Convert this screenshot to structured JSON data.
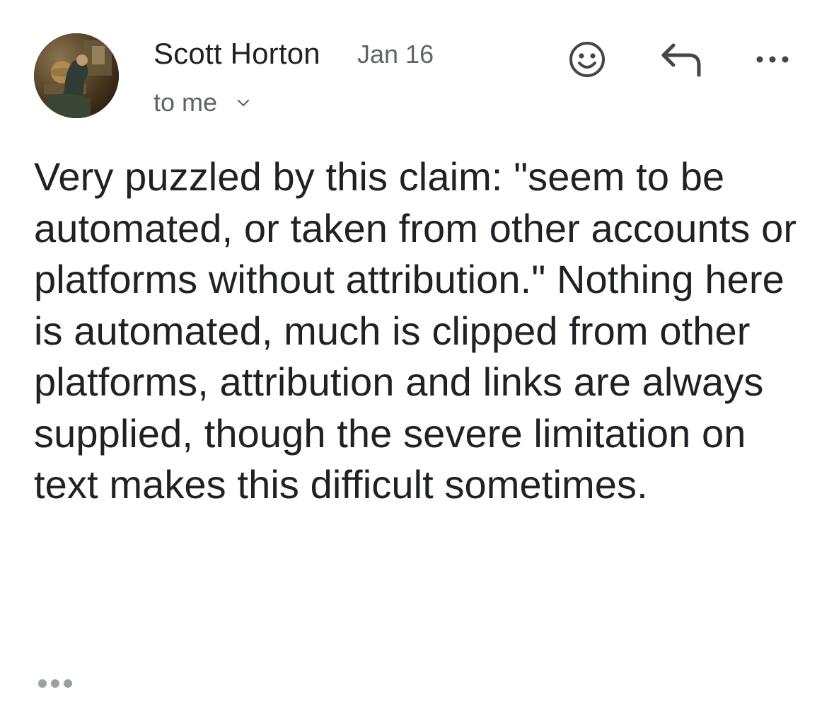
{
  "message": {
    "sender_name": "Scott Horton",
    "date": "Jan 16",
    "recipient": "to me",
    "body": "Very puzzled by this claim: \"seem to be automated, or taken from other accounts or platforms without attribution.\" Nothing here is automated, much is clipped from other platforms, attribution and links are always supplied, though the severe limitation on text makes this difficult sometimes."
  },
  "icons": {
    "avatar": "avatar-painting",
    "expand_recipients": "chevron-down-icon",
    "react": "emoji-icon",
    "reply": "reply-icon",
    "more": "more-horiz-icon",
    "show_trimmed": "ellipsis-icon"
  },
  "colors": {
    "primary_text": "#202124",
    "secondary_text": "#5f6368",
    "icon": "#444746",
    "background": "#ffffff"
  }
}
